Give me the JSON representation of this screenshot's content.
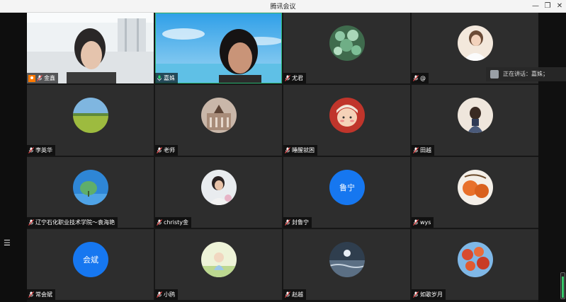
{
  "window": {
    "title": "腾讯会议",
    "minimize": "—",
    "restore": "❐",
    "close": "✕"
  },
  "speaking": {
    "text": "正在讲话：嘉姝；"
  },
  "audio_level": 0.82,
  "participants": [
    {
      "name": "金鑫"
    },
    {
      "name": "嘉姝"
    },
    {
      "name": "尤君"
    },
    {
      "name": "@"
    },
    {
      "name": "李英华"
    },
    {
      "name": "老师"
    },
    {
      "name": "睡醒就困"
    },
    {
      "name": "田越"
    },
    {
      "name": "辽宁石化职业技术学院～袁海艳"
    },
    {
      "name": "christy金"
    },
    {
      "name": "封鲁宁",
      "avatar_text": "鲁宁"
    },
    {
      "name": "wys"
    },
    {
      "name": "常会斌",
      "avatar_text": "会斌"
    },
    {
      "name": "小鸥"
    },
    {
      "name": "赵越"
    },
    {
      "name": "如歌岁月"
    }
  ]
}
